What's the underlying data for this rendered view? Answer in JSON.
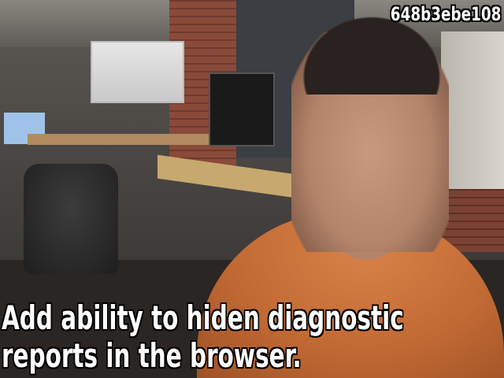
{
  "commit_sha": "648b3ebe108",
  "commit_message": {
    "line1": "Add ability to hiden diagnostic",
    "line2": "reports in the browser."
  }
}
